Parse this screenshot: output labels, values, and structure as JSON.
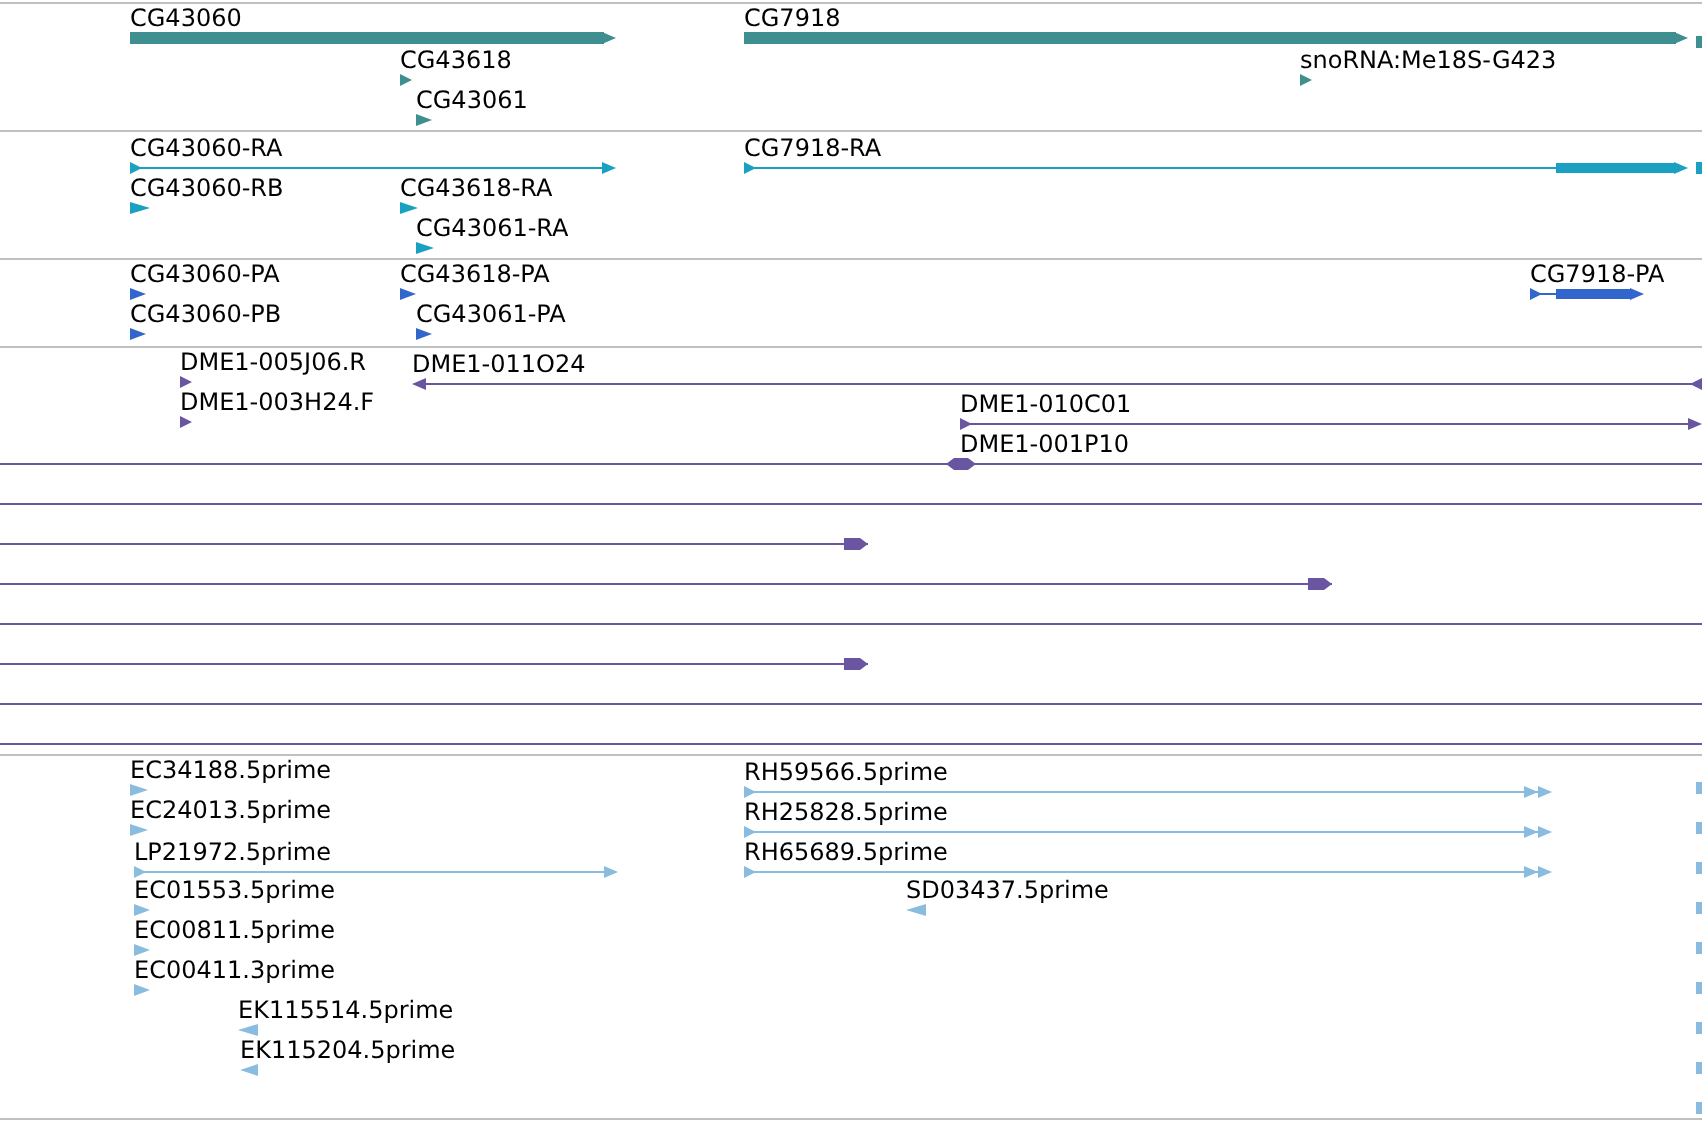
{
  "tracks": [
    {
      "kind": "gene",
      "features": [
        {
          "label": "CG43060",
          "reverse": false
        },
        {
          "label": "CG7918",
          "reverse": false
        },
        {
          "label": "CG43618",
          "reverse": false
        },
        {
          "label": "snoRNA:Me18S-G423",
          "reverse": false
        },
        {
          "label": "CG43061",
          "reverse": false
        }
      ]
    },
    {
      "kind": "transcript",
      "features": [
        {
          "label": "CG43060-RA",
          "reverse": false
        },
        {
          "label": "CG7918-RA",
          "reverse": false
        },
        {
          "label": "CG43060-RB",
          "reverse": false
        },
        {
          "label": "CG43618-RA",
          "reverse": false
        },
        {
          "label": "CG43061-RA",
          "reverse": false
        }
      ]
    },
    {
      "kind": "protein",
      "features": [
        {
          "label": "CG43060-PA",
          "reverse": false
        },
        {
          "label": "CG43618-PA",
          "reverse": false
        },
        {
          "label": "CG7918-PA",
          "reverse": false
        },
        {
          "label": "CG43060-PB",
          "reverse": false
        },
        {
          "label": "CG43061-PA",
          "reverse": false
        }
      ]
    },
    {
      "kind": "clone",
      "features": [
        {
          "label": "DME1-005J06.R",
          "reverse": false
        },
        {
          "label": "DME1-011O24",
          "reverse": true
        },
        {
          "label": "DME1-003H24.F",
          "reverse": false
        },
        {
          "label": "DME1-010C01",
          "reverse": false
        },
        {
          "label": "DME1-001P10",
          "reverse": false
        }
      ]
    },
    {
      "kind": "est",
      "features": [
        {
          "label": "EC34188.5prime",
          "reverse": false
        },
        {
          "label": "RH59566.5prime",
          "reverse": false
        },
        {
          "label": "EC24013.5prime",
          "reverse": false
        },
        {
          "label": "RH25828.5prime",
          "reverse": false
        },
        {
          "label": "LP21972.5prime",
          "reverse": false
        },
        {
          "label": "RH65689.5prime",
          "reverse": false
        },
        {
          "label": "EC01553.5prime",
          "reverse": false
        },
        {
          "label": "SD03437.5prime",
          "reverse": true
        },
        {
          "label": "EC00811.5prime",
          "reverse": false
        },
        {
          "label": "EC00411.3prime",
          "reverse": false
        },
        {
          "label": "EK115514.5prime",
          "reverse": true
        },
        {
          "label": "EK115204.5prime",
          "reverse": true
        }
      ]
    }
  ]
}
